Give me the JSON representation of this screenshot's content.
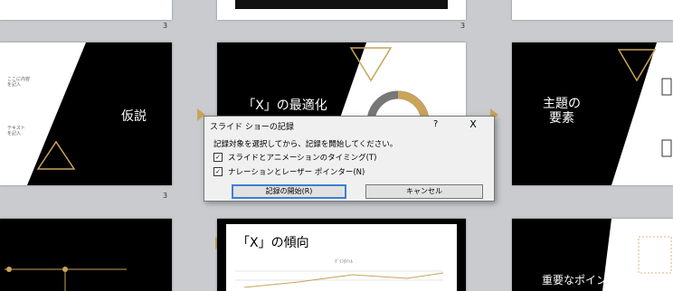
{
  "slides": {
    "numbers": [
      "3",
      "3",
      "3"
    ],
    "kasetsu_title": "仮説",
    "x_title": "「X」の最適化",
    "shudai_title": "主題の\n要素",
    "trend_title": "「X」の傾向",
    "chart_caption": "ｸﾞﾗﾌﾀｲﾄﾙ",
    "important_title": "重要なポイント",
    "tiny_text_a": "ここに内容\nを記入",
    "tiny_text_b": "テキスト\nを記入"
  },
  "dialog": {
    "title": "スライド ショーの記録",
    "help": "?",
    "close": "X",
    "instruction": "記録対象を選択してから、記録を開始してください。",
    "option1": "スライドとアニメーションのタイミング(T)",
    "option2": "ナレーションとレーザー ポインター(N)",
    "start_button": "記録の開始(R)",
    "cancel_button": "キャンセル"
  },
  "colors": {
    "accent": "#c9a45a",
    "dark": "#000000",
    "dialog_bg": "#f0f0f0",
    "focus": "#3c7fd6"
  }
}
